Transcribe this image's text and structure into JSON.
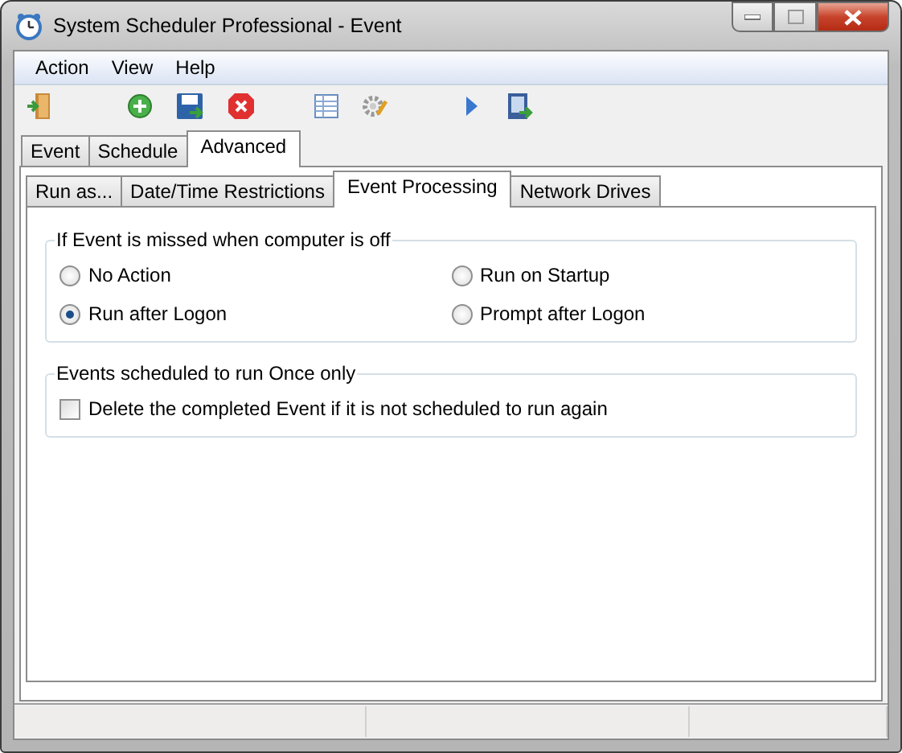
{
  "window": {
    "title": "System Scheduler Professional - Event"
  },
  "menu": [
    "Action",
    "View",
    "Help"
  ],
  "tabs": [
    {
      "label": "Event",
      "selected": false
    },
    {
      "label": "Schedule",
      "selected": false
    },
    {
      "label": "Advanced",
      "selected": true
    }
  ],
  "subtabs": [
    {
      "label": "Run as...",
      "selected": false
    },
    {
      "label": "Date/Time Restrictions",
      "selected": false
    },
    {
      "label": "Event Processing",
      "selected": true
    },
    {
      "label": "Network Drives",
      "selected": false
    }
  ],
  "groups": [
    {
      "title": "If Event is missed when computer is off",
      "options": [
        {
          "kind": "radio",
          "label": "No Action",
          "selected": false
        },
        {
          "kind": "radio",
          "label": "Run on Startup",
          "selected": false
        },
        {
          "kind": "radio",
          "label": "Run after Logon",
          "selected": true
        },
        {
          "kind": "radio",
          "label": "Prompt after Logon",
          "selected": false
        }
      ]
    },
    {
      "title": "Events scheduled to run Once only",
      "options": [
        {
          "kind": "checkbox",
          "label": "Delete the completed Event if it is not scheduled to run again",
          "checked": false
        }
      ]
    }
  ]
}
